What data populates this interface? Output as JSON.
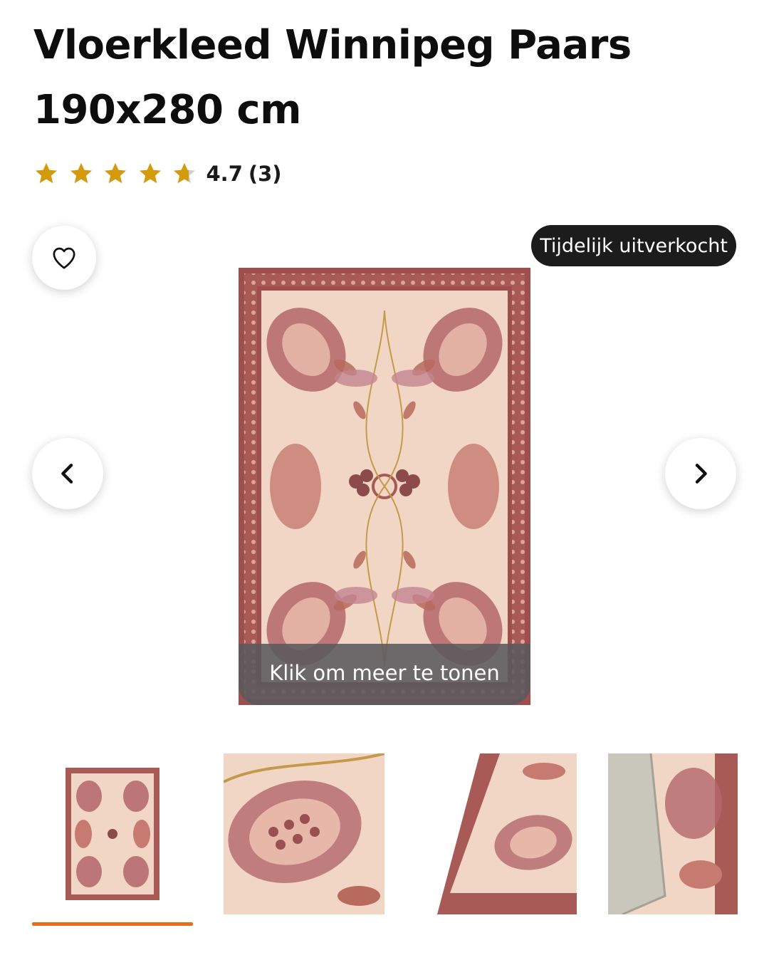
{
  "product": {
    "title_line1": "Vloerkleed Winnipeg Paars",
    "title_line2": "190x280 cm",
    "rating": {
      "value": 4.7,
      "value_text": "4.7",
      "count_text": "(3)",
      "max_stars": 5,
      "star_color": "#d39a0b",
      "empty_star_color": "#cfcfcf"
    }
  },
  "gallery": {
    "wishlist_icon": "heart-icon",
    "status_badge": "Tijdelijk uitverkocht",
    "prev_icon": "chevron-left-icon",
    "next_icon": "chevron-right-icon",
    "more_overlay_text": "Klik om meer te tonen",
    "thumbnails": [
      {
        "name": "thumb-full-rug",
        "active": true
      },
      {
        "name": "thumb-detail-closeup",
        "active": false
      },
      {
        "name": "thumb-corner-view",
        "active": false
      },
      {
        "name": "thumb-backside-view",
        "active": false
      }
    ],
    "active_indicator_color": "#e86c1f"
  },
  "colors": {
    "rug_border": "#a85a56",
    "rug_field": "#f1d6c6",
    "rug_motif": "#b4666a",
    "rug_accent": "#c49a4a",
    "badge_bg": "#1c1c1c"
  }
}
